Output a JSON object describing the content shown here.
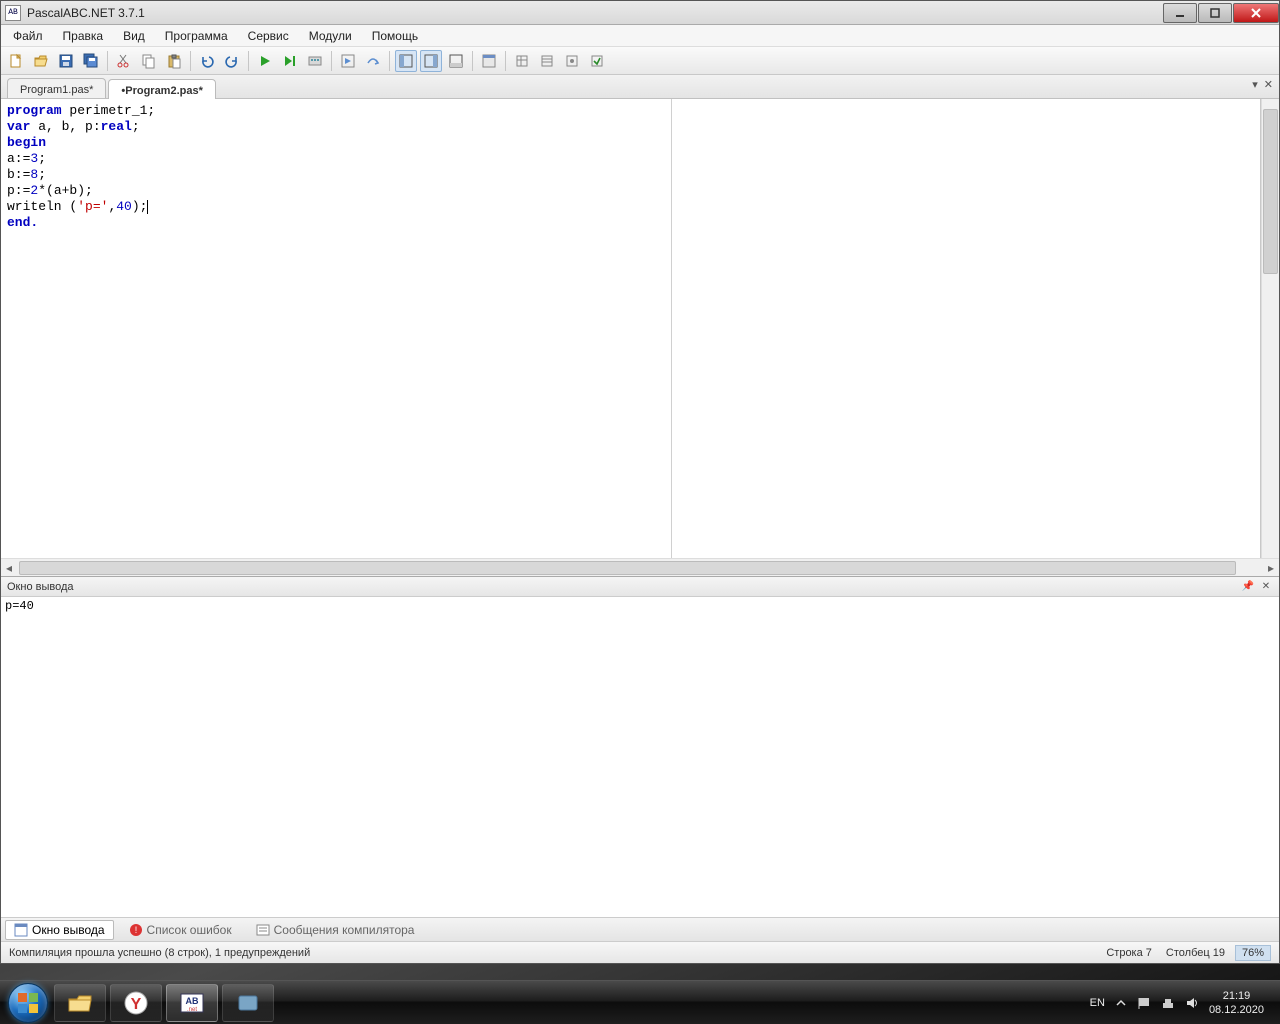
{
  "window": {
    "title": "PascalABC.NET 3.7.1"
  },
  "menu": {
    "file": "Файл",
    "edit": "Правка",
    "view": "Вид",
    "program": "Программа",
    "service": "Сервис",
    "modules": "Модули",
    "help": "Помощь"
  },
  "tabs": {
    "t1": "Program1.pas*",
    "t2": "•Program2.pas*"
  },
  "code": {
    "l1a": "program",
    "l1b": " perimetr_1;",
    "l2a": "var",
    "l2b": " a, b, p:",
    "l2c": "real",
    "l2d": ";",
    "l3": "begin",
    "l4a": "a:=",
    "l4b": "3",
    "l4c": ";",
    "l5a": "b:=",
    "l5b": "8",
    "l5c": ";",
    "l6a": "p:=",
    "l6b": "2",
    "l6c": "*(a+b);",
    "l7a": "writeln (",
    "l7b": "'p='",
    "l7c": ",",
    "l7d": "40",
    "l7e": ");",
    "l8": "end."
  },
  "output": {
    "title": "Окно вывода",
    "text": "p=40"
  },
  "bottom_tabs": {
    "out": "Окно вывода",
    "err": "Список ошибок",
    "comp": "Сообщения компилятора"
  },
  "status": {
    "compile": "Компиляция прошла успешно (8 строк), 1 предупреждений",
    "line": "Строка  7",
    "col": "Столбец  19",
    "zoom": "76%"
  },
  "tray": {
    "lang": "EN",
    "time": "21:19",
    "date": "08.12.2020"
  }
}
